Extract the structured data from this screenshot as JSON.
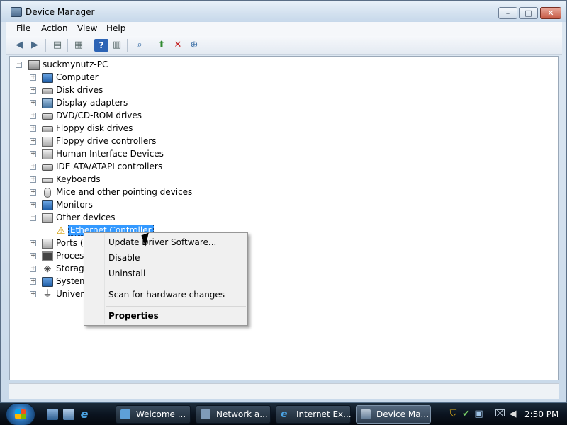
{
  "window": {
    "title": "Device Manager",
    "controls": {
      "minimize": "–",
      "maximize": "□",
      "close": "✕"
    }
  },
  "menu": [
    "File",
    "Action",
    "View",
    "Help"
  ],
  "toolbar": {
    "icons": [
      "back-icon",
      "forward-icon",
      "console-tree-icon",
      "properties-icon",
      "help-icon",
      "list-icon",
      "scan-icon",
      "update-driver-icon",
      "uninstall-icon",
      "enable-icon"
    ]
  },
  "tree": {
    "root": "suckmynutz-PC",
    "items": [
      {
        "label": "Computer",
        "icon": "computer-icon"
      },
      {
        "label": "Disk drives",
        "icon": "disk-drive-icon"
      },
      {
        "label": "Display adapters",
        "icon": "display-adapter-icon"
      },
      {
        "label": "DVD/CD-ROM drives",
        "icon": "dvd-drive-icon"
      },
      {
        "label": "Floppy disk drives",
        "icon": "floppy-drive-icon"
      },
      {
        "label": "Floppy drive controllers",
        "icon": "floppy-controller-icon"
      },
      {
        "label": "Human Interface Devices",
        "icon": "hid-icon"
      },
      {
        "label": "IDE ATA/ATAPI controllers",
        "icon": "ide-controller-icon"
      },
      {
        "label": "Keyboards",
        "icon": "keyboard-icon"
      },
      {
        "label": "Mice and other pointing devices",
        "icon": "mouse-icon"
      },
      {
        "label": "Monitors",
        "icon": "monitor-icon"
      },
      {
        "label": "Other devices",
        "icon": "other-devices-icon"
      },
      {
        "label": "Ethernet Controller",
        "icon": "warning-icon"
      },
      {
        "label": "Ports (C",
        "icon": "port-icon"
      },
      {
        "label": "Process",
        "icon": "processor-icon"
      },
      {
        "label": "Storage",
        "icon": "storage-icon"
      },
      {
        "label": "System",
        "icon": "system-icon"
      },
      {
        "label": "Universa",
        "icon": "usb-icon"
      }
    ]
  },
  "context_menu": {
    "update_driver": "Update Driver Software...",
    "disable": "Disable",
    "uninstall": "Uninstall",
    "scan": "Scan for hardware changes",
    "properties": "Properties"
  },
  "taskbar": {
    "tasks": [
      "Welcome ...",
      "Network a...",
      "Internet Ex...",
      "Device Ma..."
    ],
    "clock": "2:50 PM"
  },
  "colors": {
    "selection": "#3399ff",
    "warning": "#d39b00",
    "taskbar": "#0b1420"
  }
}
